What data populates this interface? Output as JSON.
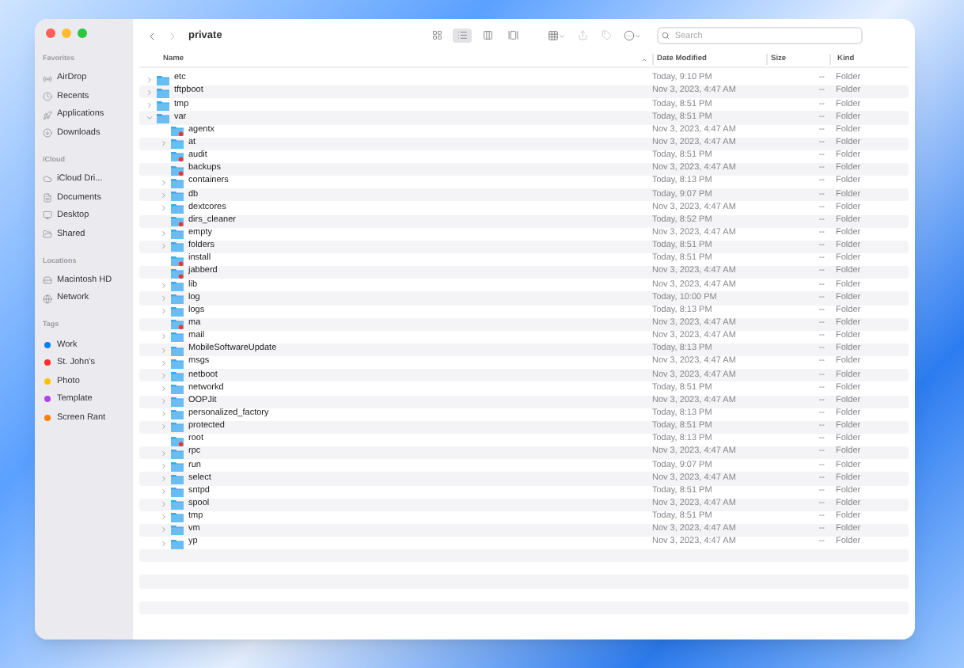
{
  "window": {
    "title": "private"
  },
  "sidebar": {
    "sections": [
      {
        "title": "Favorites",
        "items": [
          {
            "kind": "airdrop",
            "label": "AirDrop"
          },
          {
            "kind": "recents",
            "label": "Recents"
          },
          {
            "kind": "applications",
            "label": "Applications"
          },
          {
            "kind": "downloads",
            "label": "Downloads"
          }
        ]
      },
      {
        "title": "iCloud",
        "items": [
          {
            "kind": "icloud",
            "label": "iCloud Dri..."
          },
          {
            "kind": "documents",
            "label": "Documents"
          },
          {
            "kind": "desktop",
            "label": "Desktop"
          },
          {
            "kind": "shared",
            "label": "Shared"
          }
        ]
      },
      {
        "title": "Locations",
        "items": [
          {
            "kind": "disk",
            "label": "Macintosh HD"
          },
          {
            "kind": "network",
            "label": "Network"
          }
        ]
      },
      {
        "title": "Tags",
        "items": [
          {
            "kind": "tag",
            "label": "Work",
            "color": "#0a7cff"
          },
          {
            "kind": "tag",
            "label": "St. John's",
            "color": "#ff2d2d"
          },
          {
            "kind": "tag",
            "label": "Photo",
            "color": "#ffbf00"
          },
          {
            "kind": "tag",
            "label": "Template",
            "color": "#b245e6"
          },
          {
            "kind": "tag",
            "label": "Screen Rant",
            "color": "#ff8000"
          }
        ]
      }
    ]
  },
  "toolbar": {
    "views": [
      {
        "kind": "icons",
        "selected": false
      },
      {
        "kind": "list",
        "selected": true
      },
      {
        "kind": "columns",
        "selected": false
      },
      {
        "kind": "gallery",
        "selected": false
      }
    ],
    "search": {
      "placeholder": "Search"
    }
  },
  "table": {
    "columns": [
      "Name",
      "Date Modified",
      "Size",
      "Kind"
    ],
    "rows": [
      {
        "name": "etc",
        "date": "Today, 9:10 PM",
        "size": "--",
        "kind": "Folder",
        "locked": false,
        "expanded": false
      },
      {
        "name": "tftpboot",
        "date": "Nov 3, 2023, 4:47 AM",
        "size": "--",
        "kind": "Folder",
        "locked": false,
        "expanded": false
      },
      {
        "name": "tmp",
        "date": "Today, 8:51 PM",
        "size": "--",
        "kind": "Folder",
        "locked": false,
        "expanded": false
      },
      {
        "name": "var",
        "date": "Today, 8:51 PM",
        "size": "--",
        "kind": "Folder",
        "locked": false,
        "expanded": true,
        "children": [
          {
            "name": "agentx",
            "date": "Nov 3, 2023, 4:47 AM",
            "size": "--",
            "kind": "Folder",
            "locked": true
          },
          {
            "name": "at",
            "date": "Nov 3, 2023, 4:47 AM",
            "size": "--",
            "kind": "Folder",
            "locked": false
          },
          {
            "name": "audit",
            "date": "Today, 8:51 PM",
            "size": "--",
            "kind": "Folder",
            "locked": true
          },
          {
            "name": "backups",
            "date": "Nov 3, 2023, 4:47 AM",
            "size": "--",
            "kind": "Folder",
            "locked": true
          },
          {
            "name": "containers",
            "date": "Today, 8:13 PM",
            "size": "--",
            "kind": "Folder",
            "locked": false
          },
          {
            "name": "db",
            "date": "Today, 9:07 PM",
            "size": "--",
            "kind": "Folder",
            "locked": false
          },
          {
            "name": "dextcores",
            "date": "Nov 3, 2023, 4:47 AM",
            "size": "--",
            "kind": "Folder",
            "locked": false
          },
          {
            "name": "dirs_cleaner",
            "date": "Today, 8:52 PM",
            "size": "--",
            "kind": "Folder",
            "locked": true
          },
          {
            "name": "empty",
            "date": "Nov 3, 2023, 4:47 AM",
            "size": "--",
            "kind": "Folder",
            "locked": false
          },
          {
            "name": "folders",
            "date": "Today, 8:51 PM",
            "size": "--",
            "kind": "Folder",
            "locked": false
          },
          {
            "name": "install",
            "date": "Today, 8:51 PM",
            "size": "--",
            "kind": "Folder",
            "locked": true
          },
          {
            "name": "jabberd",
            "date": "Nov 3, 2023, 4:47 AM",
            "size": "--",
            "kind": "Folder",
            "locked": true
          },
          {
            "name": "lib",
            "date": "Nov 3, 2023, 4:47 AM",
            "size": "--",
            "kind": "Folder",
            "locked": false
          },
          {
            "name": "log",
            "date": "Today, 10:00 PM",
            "size": "--",
            "kind": "Folder",
            "locked": false
          },
          {
            "name": "logs",
            "date": "Today, 8:13 PM",
            "size": "--",
            "kind": "Folder",
            "locked": false
          },
          {
            "name": "ma",
            "date": "Nov 3, 2023, 4:47 AM",
            "size": "--",
            "kind": "Folder",
            "locked": true
          },
          {
            "name": "mail",
            "date": "Nov 3, 2023, 4:47 AM",
            "size": "--",
            "kind": "Folder",
            "locked": false
          },
          {
            "name": "MobileSoftwareUpdate",
            "date": "Today, 8:13 PM",
            "size": "--",
            "kind": "Folder",
            "locked": false
          },
          {
            "name": "msgs",
            "date": "Nov 3, 2023, 4:47 AM",
            "size": "--",
            "kind": "Folder",
            "locked": false
          },
          {
            "name": "netboot",
            "date": "Nov 3, 2023, 4:47 AM",
            "size": "--",
            "kind": "Folder",
            "locked": false
          },
          {
            "name": "networkd",
            "date": "Today, 8:51 PM",
            "size": "--",
            "kind": "Folder",
            "locked": false
          },
          {
            "name": "OOPJit",
            "date": "Nov 3, 2023, 4:47 AM",
            "size": "--",
            "kind": "Folder",
            "locked": false
          },
          {
            "name": "personalized_factory",
            "date": "Today, 8:13 PM",
            "size": "--",
            "kind": "Folder",
            "locked": false
          },
          {
            "name": "protected",
            "date": "Today, 8:51 PM",
            "size": "--",
            "kind": "Folder",
            "locked": false
          },
          {
            "name": "root",
            "date": "Today, 8:13 PM",
            "size": "--",
            "kind": "Folder",
            "locked": true
          },
          {
            "name": "rpc",
            "date": "Nov 3, 2023, 4:47 AM",
            "size": "--",
            "kind": "Folder",
            "locked": false
          },
          {
            "name": "run",
            "date": "Today, 9:07 PM",
            "size": "--",
            "kind": "Folder",
            "locked": false
          },
          {
            "name": "select",
            "date": "Nov 3, 2023, 4:47 AM",
            "size": "--",
            "kind": "Folder",
            "locked": false
          },
          {
            "name": "sntpd",
            "date": "Today, 8:51 PM",
            "size": "--",
            "kind": "Folder",
            "locked": false
          },
          {
            "name": "spool",
            "date": "Nov 3, 2023, 4:47 AM",
            "size": "--",
            "kind": "Folder",
            "locked": false
          },
          {
            "name": "tmp",
            "date": "Today, 8:51 PM",
            "size": "--",
            "kind": "Folder",
            "locked": false
          },
          {
            "name": "vm",
            "date": "Nov 3, 2023, 4:47 AM",
            "size": "--",
            "kind": "Folder",
            "locked": false
          },
          {
            "name": "yp",
            "date": "Nov 3, 2023, 4:47 AM",
            "size": "--",
            "kind": "Folder",
            "locked": false
          }
        ]
      }
    ]
  }
}
